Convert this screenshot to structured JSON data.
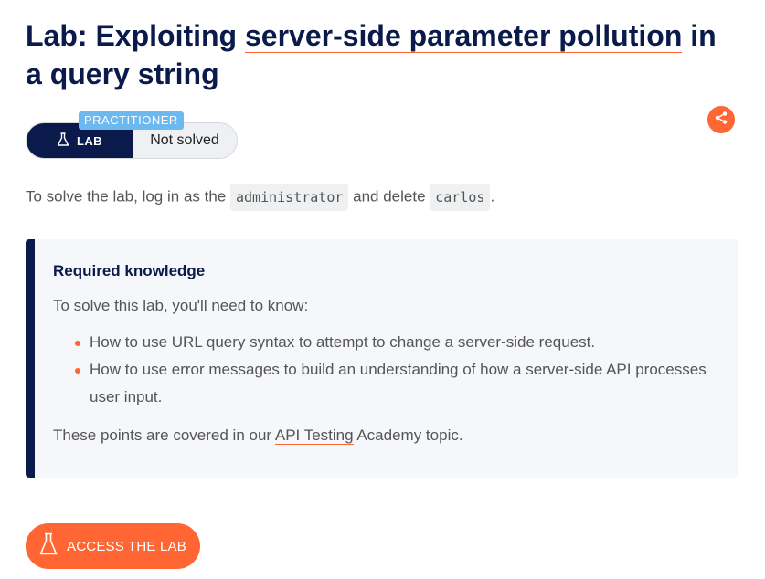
{
  "header": {
    "title_prefix": "Lab: Exploiting ",
    "title_link": "server-side parameter pollution",
    "title_suffix": " in a query string"
  },
  "badge": {
    "level": "PRACTITIONER",
    "lab_label": "LAB",
    "status": "Not solved"
  },
  "share": {
    "icon": "share-icon"
  },
  "intro": {
    "text_before": "To solve the lab, log in as the ",
    "code_user": "administrator",
    "text_middle": " and delete ",
    "code_target": "carlos",
    "text_after": "."
  },
  "knowledge": {
    "title": "Required knowledge",
    "intro": "To solve this lab, you'll need to know:",
    "items": [
      "How to use URL query syntax to attempt to change a server-side request.",
      "How to use error messages to build an understanding of how a server-side API processes user input."
    ],
    "footer_before": "These points are covered in our ",
    "footer_link": "API Testing",
    "footer_after": " Academy topic."
  },
  "access": {
    "label": "ACCESS THE LAB",
    "icon": "flask-icon"
  },
  "colors": {
    "navy": "#0a1a4a",
    "accent": "#ff6633",
    "level_tag": "#6cb9f0"
  }
}
